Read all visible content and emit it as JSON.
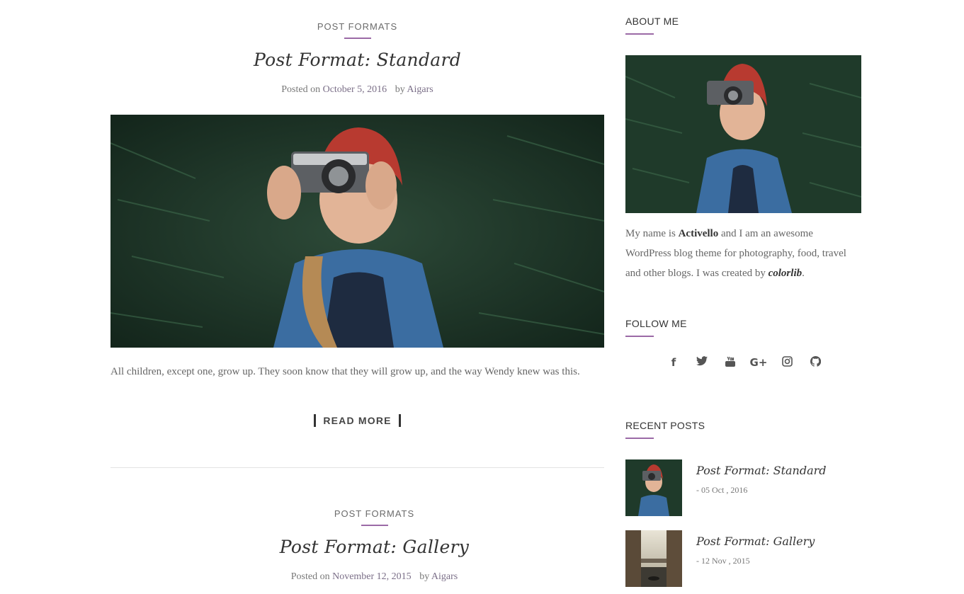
{
  "posts": [
    {
      "category": "POST FORMATS",
      "title": "Post Format: Standard",
      "posted_on": "Posted on",
      "date": "October 5, 2016",
      "by": "by",
      "author": "Aigars",
      "excerpt": "All children, except one, grow up. They soon know that they will grow up, and the way Wendy knew was this.",
      "read_more": "READ MORE"
    },
    {
      "category": "POST FORMATS",
      "title": "Post Format: Gallery",
      "posted_on": "Posted on",
      "date": "November 12, 2015",
      "by": "by",
      "author": "Aigars"
    }
  ],
  "sidebar": {
    "about": {
      "title": "ABOUT ME",
      "text_1": "My name is",
      "name": "Activello",
      "text_2": "and I am an awesome WordPress blog theme for photography, food, travel and other blogs. I was created by",
      "creator": "colorlib",
      "text_3": "."
    },
    "follow": {
      "title": "FOLLOW ME",
      "icons": [
        "facebook-icon",
        "twitter-icon",
        "youtube-icon",
        "google-plus-icon",
        "instagram-icon",
        "github-icon"
      ]
    },
    "recent": {
      "title": "RECENT POSTS",
      "items": [
        {
          "title": "Post Format: Standard",
          "date": "- 05 Oct , 2016"
        },
        {
          "title": "Post Format: Gallery",
          "date": "- 12 Nov , 2015"
        }
      ]
    }
  },
  "colors": {
    "accent": "#9b6aa6"
  }
}
